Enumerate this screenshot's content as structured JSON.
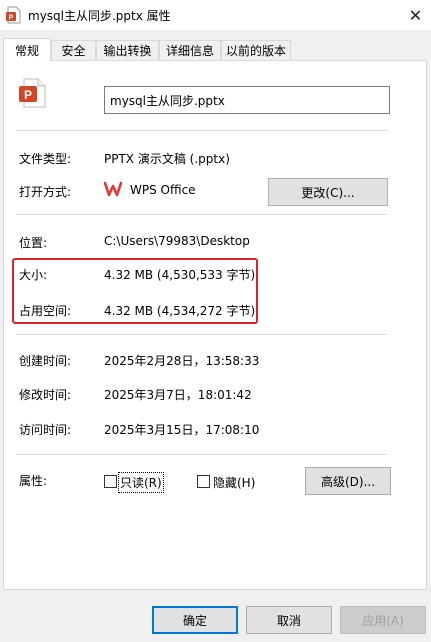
{
  "window": {
    "title": "mysql主从同步.pptx 属性",
    "close": "✕"
  },
  "tabs": [
    {
      "label": "常规",
      "active": true
    },
    {
      "label": "安全"
    },
    {
      "label": "输出转换"
    },
    {
      "label": "详细信息"
    },
    {
      "label": "以前的版本"
    }
  ],
  "general": {
    "file_name": "mysql主从同步.pptx",
    "file_type_label": "文件类型:",
    "file_type_value": "PPTX 演示文稿 (.pptx)",
    "open_with_label": "打开方式:",
    "open_with_value": "WPS Office",
    "change_button": "更改(C)...",
    "location_label": "位置:",
    "location_value": "C:\\Users\\79983\\Desktop",
    "size_label": "大小:",
    "size_value": "4.32 MB (4,530,533 字节)",
    "size_on_disk_label": "占用空间:",
    "size_on_disk_value": "4.32 MB (4,534,272 字节)",
    "created_label": "创建时间:",
    "created_value": "2025年2月28日，13:58:33",
    "modified_label": "修改时间:",
    "modified_value": "2025年3月7日，18:01:42",
    "accessed_label": "访问时间:",
    "accessed_value": "2025年3月15日，17:08:10",
    "attributes_label": "属性:",
    "readonly_label": "只读(R)",
    "readonly_checked": false,
    "hidden_label": "隐藏(H)",
    "hidden_checked": false,
    "advanced_button": "高级(D)..."
  },
  "footer": {
    "ok": "确定",
    "cancel": "取消",
    "apply": "应用(A)"
  },
  "colors": {
    "highlight_border": "#e0202a",
    "ppt_icon": "#d24726",
    "wps_logo": "#e53935"
  }
}
